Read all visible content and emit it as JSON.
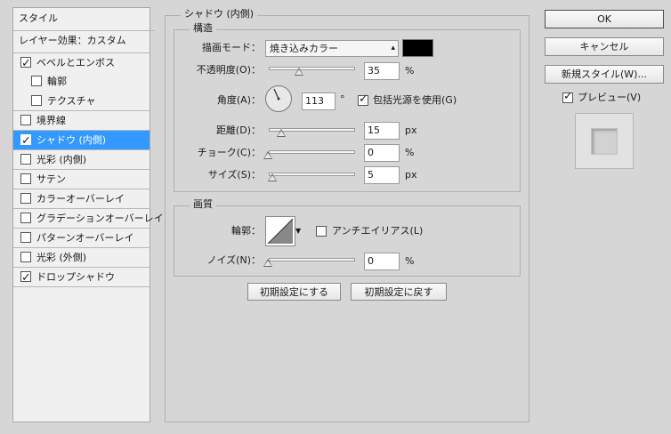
{
  "sidebar": {
    "header": "スタイル",
    "subheader": "レイヤー効果：カスタム",
    "items": [
      {
        "label": "ベベルとエンボス",
        "checked": true
      },
      {
        "label": "輪郭",
        "checked": false
      },
      {
        "label": "テクスチャ",
        "checked": false
      },
      {
        "label": "境界線",
        "checked": false
      },
      {
        "label": "シャドウ (内側)",
        "checked": true,
        "selected": true
      },
      {
        "label": "光彩 (内側)",
        "checked": false
      },
      {
        "label": "サテン",
        "checked": false
      },
      {
        "label": "カラーオーバーレイ",
        "checked": false
      },
      {
        "label": "グラデーションオーバーレイ",
        "checked": false
      },
      {
        "label": "パターンオーバーレイ",
        "checked": false
      },
      {
        "label": "光彩 (外側)",
        "checked": false
      },
      {
        "label": "ドロップシャドウ",
        "checked": true
      }
    ]
  },
  "panel": {
    "title": "シャドウ (内側)",
    "structure": {
      "title": "構造",
      "blend_mode_label": "描画モード：",
      "blend_mode_value": "焼き込みカラー",
      "blend_color": "#000000",
      "opacity_label": "不透明度(O)：",
      "opacity_value": "35",
      "opacity_unit": "%",
      "angle_label": "角度(A)：",
      "angle_value": "113",
      "angle_unit": "°",
      "global_light_label": "包括光源を使用(G)",
      "global_light_checked": true,
      "distance_label": "距離(D)：",
      "distance_value": "15",
      "distance_unit": "px",
      "choke_label": "チョーク(C)：",
      "choke_value": "0",
      "choke_unit": "%",
      "size_label": "サイズ(S)：",
      "size_value": "5",
      "size_unit": "px"
    },
    "quality": {
      "title": "画質",
      "contour_label": "輪郭：",
      "antialias_label": "アンチエイリアス(L)",
      "antialias_checked": false,
      "noise_label": "ノイズ(N)：",
      "noise_value": "0",
      "noise_unit": "%"
    },
    "make_default_label": "初期設定にする",
    "reset_default_label": "初期設定に戻す"
  },
  "actions": {
    "ok_label": "OK",
    "cancel_label": "キャンセル",
    "new_style_label": "新規スタイル(W)...",
    "preview_label": "プレビュー(V)",
    "preview_checked": true
  }
}
